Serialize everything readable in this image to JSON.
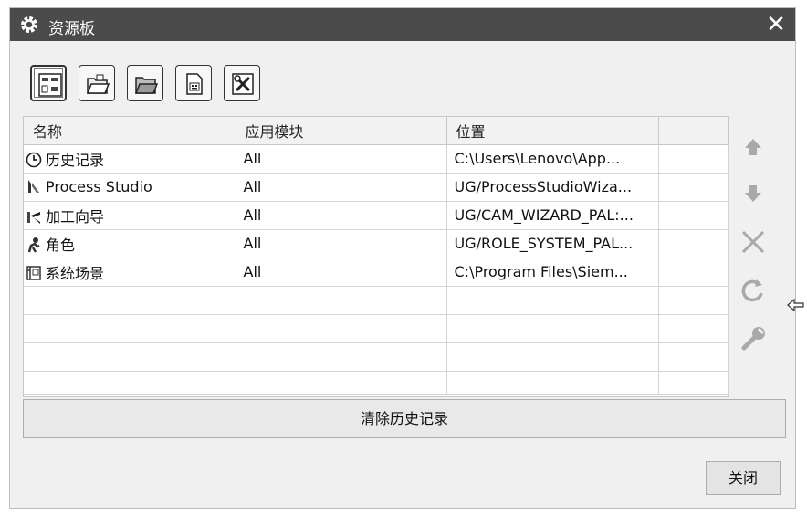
{
  "window": {
    "title": "资源板",
    "close_glyph": "✕"
  },
  "toolbar": {
    "buttons": [
      {
        "icon": "resource-bar-view-icon",
        "active": true
      },
      {
        "icon": "open-folder-icon",
        "active": false
      },
      {
        "icon": "folder-icon",
        "active": false
      },
      {
        "icon": "template-file-icon",
        "active": false
      },
      {
        "icon": "tools-options-icon",
        "active": false
      }
    ]
  },
  "table": {
    "headers": [
      "名称",
      "应用模块",
      "位置",
      ""
    ],
    "rows": [
      {
        "icon": "history-clock-icon",
        "name": "历史记录",
        "app": "All",
        "location": "C:\\Users\\Lenovo\\App..."
      },
      {
        "icon": "process-studio-icon",
        "name": "Process Studio",
        "app": "All",
        "location": "UG/ProcessStudioWiza..."
      },
      {
        "icon": "machining-wizard-icon",
        "name": "加工向导",
        "app": "All",
        "location": "UG/CAM_WIZARD_PAL:..."
      },
      {
        "icon": "role-icon",
        "name": "角色",
        "app": "All",
        "location": "UG/ROLE_SYSTEM_PAL..."
      },
      {
        "icon": "system-scene-icon",
        "name": "系统场景",
        "app": "All",
        "location": "C:\\Program Files\\Siem..."
      }
    ],
    "empty_rows": 4
  },
  "side_buttons": [
    "move-up-icon",
    "move-down-icon",
    "remove-icon",
    "refresh-icon",
    "properties-wrench-icon"
  ],
  "actions": {
    "clear_history": "清除历史记录",
    "close": "关闭"
  },
  "colors": {
    "titlebar": "#4b4b4b",
    "dialog_bg": "#f0f0f0",
    "disabled_icon": "#a9a9a9"
  }
}
